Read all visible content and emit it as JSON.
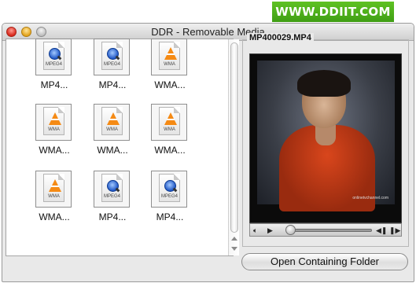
{
  "watermark": "WWW.DDIIT.COM",
  "window": {
    "title": "DDR - Removable Media"
  },
  "files": [
    {
      "label": "MP4...",
      "type": "MPEG4",
      "icon": "quicktime-icon"
    },
    {
      "label": "MP4...",
      "type": "MPEG4",
      "icon": "quicktime-icon"
    },
    {
      "label": "WMA...",
      "type": "WMA",
      "icon": "vlc-cone-icon"
    },
    {
      "label": "WMA...",
      "type": "WMA",
      "icon": "vlc-cone-icon"
    },
    {
      "label": "WMA...",
      "type": "WMA",
      "icon": "vlc-cone-icon"
    },
    {
      "label": "WMA...",
      "type": "WMA",
      "icon": "vlc-cone-icon"
    },
    {
      "label": "WMA...",
      "type": "WMA",
      "icon": "vlc-cone-icon"
    },
    {
      "label": "MP4...",
      "type": "MPEG4",
      "icon": "quicktime-icon"
    },
    {
      "label": "MP4...",
      "type": "MPEG4",
      "icon": "quicktime-icon"
    }
  ],
  "preview": {
    "filename": "MP400029.MP4",
    "credit": "onlinetvchannel.com"
  },
  "player": {
    "volume_icon": "speaker-icon",
    "play_icon": "play-icon",
    "rewind_icon": "rewind-icon",
    "forward_icon": "fast-forward-icon",
    "position_fraction": 0.05
  },
  "buttons": {
    "open_folder": "Open Containing Folder"
  },
  "colors": {
    "watermark_bg": "#4caf1a",
    "video_bg": "#0b0b0b"
  }
}
